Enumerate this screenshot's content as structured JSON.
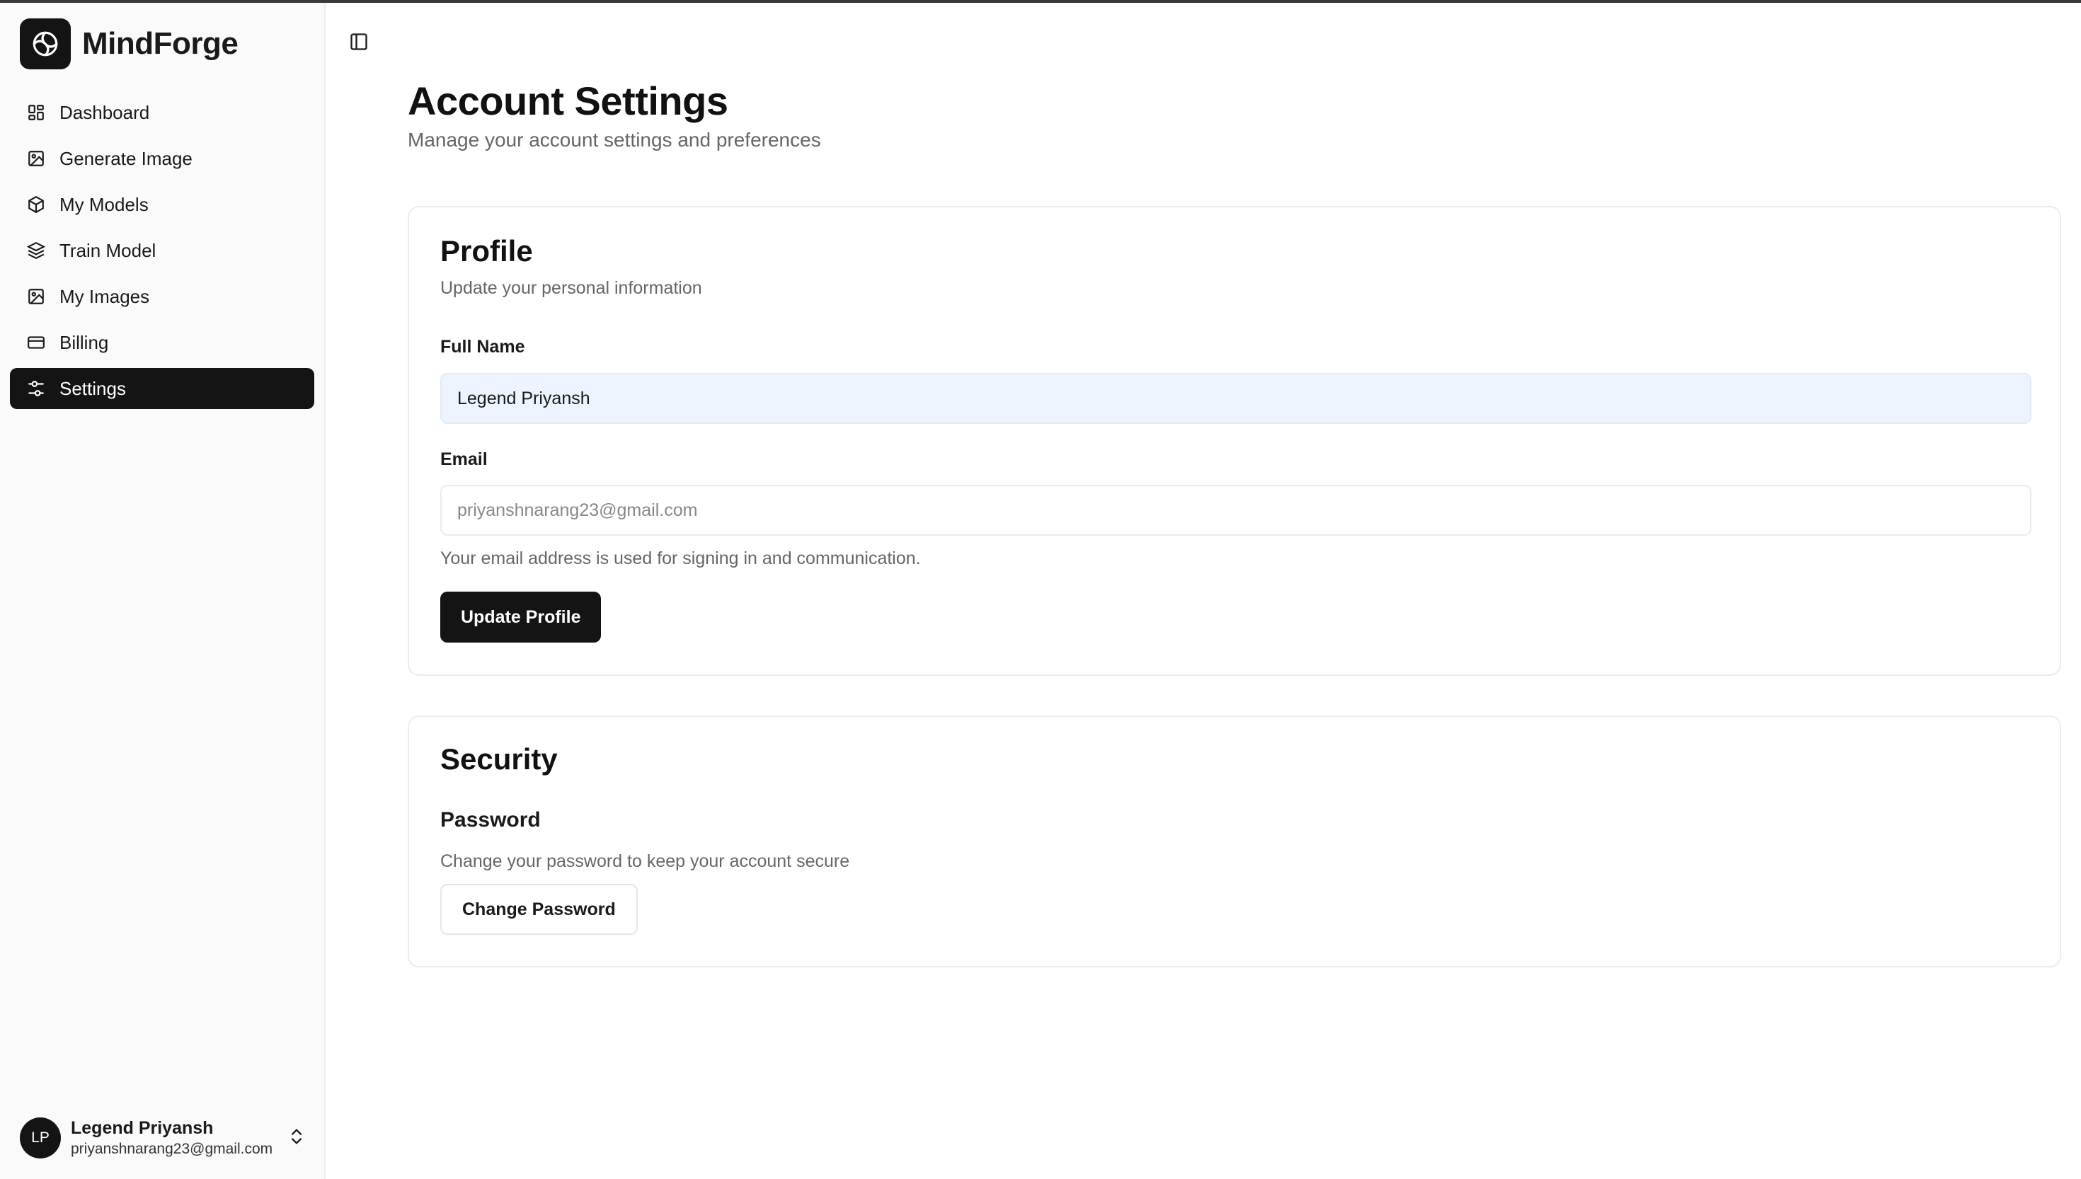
{
  "app": {
    "name": "MindForge"
  },
  "sidebar": {
    "items": [
      {
        "label": "Dashboard",
        "icon": "dashboard-icon"
      },
      {
        "label": "Generate Image",
        "icon": "image-icon"
      },
      {
        "label": "My Models",
        "icon": "cube-icon"
      },
      {
        "label": "Train Model",
        "icon": "layers-icon"
      },
      {
        "label": "My Images",
        "icon": "image-icon"
      },
      {
        "label": "Billing",
        "icon": "credit-card-icon"
      },
      {
        "label": "Settings",
        "icon": "settings-sliders-icon",
        "active": true
      }
    ],
    "user": {
      "initials": "LP",
      "name": "Legend Priyansh",
      "email": "priyanshnarang23@gmail.com"
    }
  },
  "page": {
    "title": "Account Settings",
    "subtitle": "Manage your account settings and preferences"
  },
  "profile": {
    "title": "Profile",
    "description": "Update your personal information",
    "full_name_label": "Full Name",
    "full_name_value": "Legend Priyansh",
    "email_label": "Email",
    "email_value": "priyanshnarang23@gmail.com",
    "email_help": "Your email address is used for signing in and communication.",
    "update_button": "Update Profile"
  },
  "security": {
    "title": "Security",
    "password_heading": "Password",
    "password_description": "Change your password to keep your account secure",
    "change_password_button": "Change Password"
  },
  "colors": {
    "primary": "#141414",
    "sidebar_bg": "#fafafa",
    "input_filled_bg": "#eef4fd",
    "muted_text": "#666666"
  }
}
